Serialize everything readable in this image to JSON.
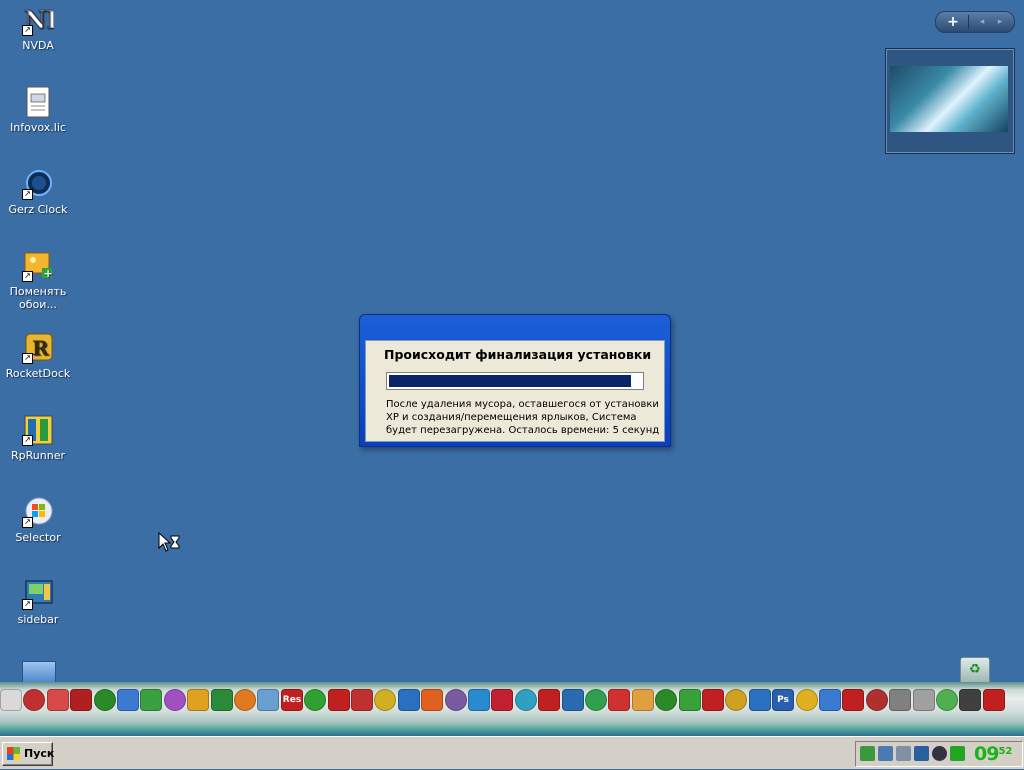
{
  "desktop": {
    "icons": [
      {
        "label": "NVDA"
      },
      {
        "label": "Infovox.lic"
      },
      {
        "label": "Gerz Clock"
      },
      {
        "label": "Поменять обои..."
      },
      {
        "label": "RocketDock"
      },
      {
        "label": "RpRunner"
      },
      {
        "label": "Selector"
      },
      {
        "label": "sidebar"
      }
    ]
  },
  "dialog": {
    "title": "Происходит финализация установки",
    "progress": 0.96,
    "message": "После удаления мусора, оставшегося от установки XP и создания/перемещения ярлыков, Система будет перезагружена. Осталось времени: 5 секунд"
  },
  "gadget": {
    "add_label": "+",
    "prev_label": "◂",
    "next_label": "▸"
  },
  "dock": {
    "items": [
      {
        "label": "Res",
        "color": "#c02020"
      },
      {
        "label": "Ps",
        "color": "#2a5fb0"
      }
    ]
  },
  "taskbar": {
    "start_label": "Пуск",
    "clock_hour": "09",
    "clock_minute": "52"
  },
  "colors": {
    "desktop": "#3b6ea5",
    "dialog_title": "#0a3fbf",
    "progress_fill": "#0a246a",
    "clock": "#1db31d"
  }
}
